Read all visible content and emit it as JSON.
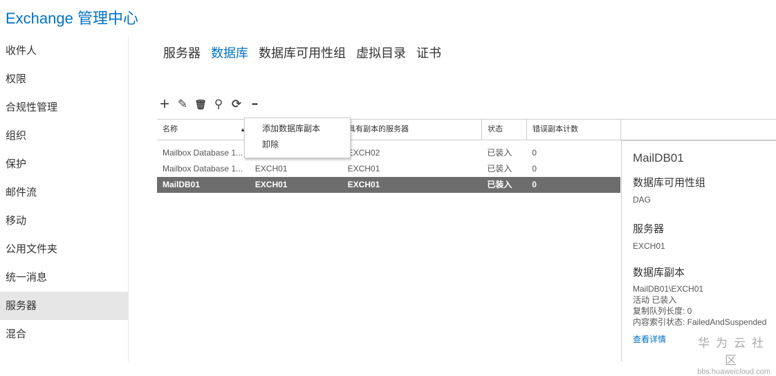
{
  "app_title": "Exchange 管理中心",
  "sidebar": {
    "items": [
      {
        "label": "收件人"
      },
      {
        "label": "权限"
      },
      {
        "label": "合规性管理"
      },
      {
        "label": "组织"
      },
      {
        "label": "保护"
      },
      {
        "label": "邮件流"
      },
      {
        "label": "移动"
      },
      {
        "label": "公用文件夹"
      },
      {
        "label": "统一消息"
      },
      {
        "label": "服务器",
        "active": true
      },
      {
        "label": "混合"
      }
    ]
  },
  "tabs": [
    {
      "label": "服务器"
    },
    {
      "label": "数据库",
      "active": true
    },
    {
      "label": "数据库可用性组"
    },
    {
      "label": "虚拟目录"
    },
    {
      "label": "证书"
    }
  ],
  "toolbar": {
    "add": "+",
    "edit": "✎",
    "delete": "🗑",
    "search": "⚲",
    "refresh": "⟳",
    "more": "•••"
  },
  "grid": {
    "headers": [
      "名称",
      "",
      "具有副本的服务器",
      "状态",
      "错误副本计数"
    ],
    "rows": [
      [
        "Mailbox Database 1...",
        "",
        "EXCH02",
        "已装入",
        "0"
      ],
      [
        "Mailbox Database 1...",
        "EXCH01",
        "EXCH01",
        "已装入",
        "0"
      ],
      [
        "MailDB01",
        "EXCH01",
        "EXCH01",
        "已装入",
        "0"
      ]
    ]
  },
  "context_menu": [
    "添加数据库副本",
    "卸除"
  ],
  "detail": {
    "name": "MailDB01",
    "dag_heading": "数据库可用性组",
    "dag": "DAG",
    "server_heading": "服务器",
    "server": "EXCH01",
    "copies_heading": "数据库副本",
    "copy_name": "MailDB01\\EXCH01",
    "copy_status": "活动 已装入",
    "queue": "复制队列长度: 0",
    "index": "内容索引状态: FailedAndSuspended",
    "link": "查看详情"
  },
  "watermark": {
    "line1": "华为云社区",
    "line2": "bbs.huaweicloud.com"
  }
}
